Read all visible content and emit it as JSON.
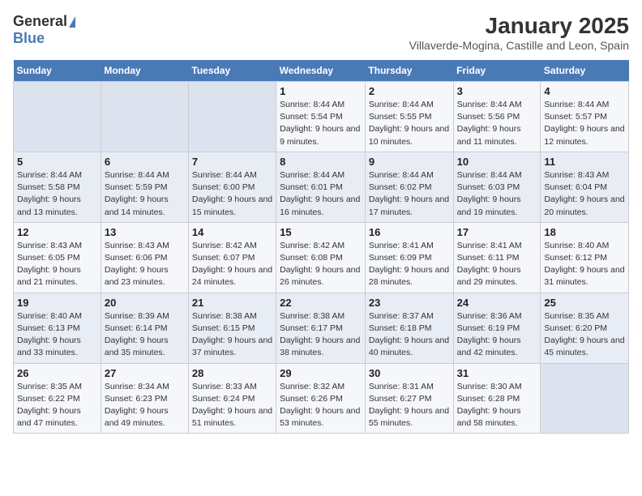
{
  "logo": {
    "general": "General",
    "blue": "Blue"
  },
  "title": "January 2025",
  "subtitle": "Villaverde-Mogina, Castille and Leon, Spain",
  "days_of_week": [
    "Sunday",
    "Monday",
    "Tuesday",
    "Wednesday",
    "Thursday",
    "Friday",
    "Saturday"
  ],
  "weeks": [
    [
      {
        "day": "",
        "empty": true
      },
      {
        "day": "",
        "empty": true
      },
      {
        "day": "",
        "empty": true
      },
      {
        "day": "1",
        "sunrise": "8:44 AM",
        "sunset": "5:54 PM",
        "daylight": "9 hours and 9 minutes."
      },
      {
        "day": "2",
        "sunrise": "8:44 AM",
        "sunset": "5:55 PM",
        "daylight": "9 hours and 10 minutes."
      },
      {
        "day": "3",
        "sunrise": "8:44 AM",
        "sunset": "5:56 PM",
        "daylight": "9 hours and 11 minutes."
      },
      {
        "day": "4",
        "sunrise": "8:44 AM",
        "sunset": "5:57 PM",
        "daylight": "9 hours and 12 minutes."
      }
    ],
    [
      {
        "day": "5",
        "sunrise": "8:44 AM",
        "sunset": "5:58 PM",
        "daylight": "9 hours and 13 minutes."
      },
      {
        "day": "6",
        "sunrise": "8:44 AM",
        "sunset": "5:59 PM",
        "daylight": "9 hours and 14 minutes."
      },
      {
        "day": "7",
        "sunrise": "8:44 AM",
        "sunset": "6:00 PM",
        "daylight": "9 hours and 15 minutes."
      },
      {
        "day": "8",
        "sunrise": "8:44 AM",
        "sunset": "6:01 PM",
        "daylight": "9 hours and 16 minutes."
      },
      {
        "day": "9",
        "sunrise": "8:44 AM",
        "sunset": "6:02 PM",
        "daylight": "9 hours and 17 minutes."
      },
      {
        "day": "10",
        "sunrise": "8:44 AM",
        "sunset": "6:03 PM",
        "daylight": "9 hours and 19 minutes."
      },
      {
        "day": "11",
        "sunrise": "8:43 AM",
        "sunset": "6:04 PM",
        "daylight": "9 hours and 20 minutes."
      }
    ],
    [
      {
        "day": "12",
        "sunrise": "8:43 AM",
        "sunset": "6:05 PM",
        "daylight": "9 hours and 21 minutes."
      },
      {
        "day": "13",
        "sunrise": "8:43 AM",
        "sunset": "6:06 PM",
        "daylight": "9 hours and 23 minutes."
      },
      {
        "day": "14",
        "sunrise": "8:42 AM",
        "sunset": "6:07 PM",
        "daylight": "9 hours and 24 minutes."
      },
      {
        "day": "15",
        "sunrise": "8:42 AM",
        "sunset": "6:08 PM",
        "daylight": "9 hours and 26 minutes."
      },
      {
        "day": "16",
        "sunrise": "8:41 AM",
        "sunset": "6:09 PM",
        "daylight": "9 hours and 28 minutes."
      },
      {
        "day": "17",
        "sunrise": "8:41 AM",
        "sunset": "6:11 PM",
        "daylight": "9 hours and 29 minutes."
      },
      {
        "day": "18",
        "sunrise": "8:40 AM",
        "sunset": "6:12 PM",
        "daylight": "9 hours and 31 minutes."
      }
    ],
    [
      {
        "day": "19",
        "sunrise": "8:40 AM",
        "sunset": "6:13 PM",
        "daylight": "9 hours and 33 minutes."
      },
      {
        "day": "20",
        "sunrise": "8:39 AM",
        "sunset": "6:14 PM",
        "daylight": "9 hours and 35 minutes."
      },
      {
        "day": "21",
        "sunrise": "8:38 AM",
        "sunset": "6:15 PM",
        "daylight": "9 hours and 37 minutes."
      },
      {
        "day": "22",
        "sunrise": "8:38 AM",
        "sunset": "6:17 PM",
        "daylight": "9 hours and 38 minutes."
      },
      {
        "day": "23",
        "sunrise": "8:37 AM",
        "sunset": "6:18 PM",
        "daylight": "9 hours and 40 minutes."
      },
      {
        "day": "24",
        "sunrise": "8:36 AM",
        "sunset": "6:19 PM",
        "daylight": "9 hours and 42 minutes."
      },
      {
        "day": "25",
        "sunrise": "8:35 AM",
        "sunset": "6:20 PM",
        "daylight": "9 hours and 45 minutes."
      }
    ],
    [
      {
        "day": "26",
        "sunrise": "8:35 AM",
        "sunset": "6:22 PM",
        "daylight": "9 hours and 47 minutes."
      },
      {
        "day": "27",
        "sunrise": "8:34 AM",
        "sunset": "6:23 PM",
        "daylight": "9 hours and 49 minutes."
      },
      {
        "day": "28",
        "sunrise": "8:33 AM",
        "sunset": "6:24 PM",
        "daylight": "9 hours and 51 minutes."
      },
      {
        "day": "29",
        "sunrise": "8:32 AM",
        "sunset": "6:26 PM",
        "daylight": "9 hours and 53 minutes."
      },
      {
        "day": "30",
        "sunrise": "8:31 AM",
        "sunset": "6:27 PM",
        "daylight": "9 hours and 55 minutes."
      },
      {
        "day": "31",
        "sunrise": "8:30 AM",
        "sunset": "6:28 PM",
        "daylight": "9 hours and 58 minutes."
      },
      {
        "day": "",
        "empty": true
      }
    ]
  ],
  "labels": {
    "sunrise": "Sunrise:",
    "sunset": "Sunset:",
    "daylight": "Daylight:"
  }
}
